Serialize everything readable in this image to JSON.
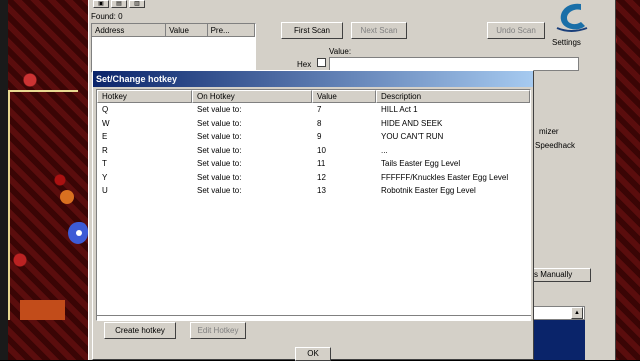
{
  "main": {
    "found": "Found: 0",
    "columns": [
      "Address",
      "Value",
      "Pre..."
    ],
    "first_scan": "First Scan",
    "next_scan": "Next Scan",
    "undo_scan": "Undo Scan",
    "value_label": "Value:",
    "hex_label": "Hex",
    "settings": "Settings",
    "side_text_1": "mizer",
    "side_text_2": "Speedhack",
    "manual_button": "s Manually"
  },
  "dialog": {
    "title": "Set/Change hotkey",
    "headers": [
      "Hotkey",
      "On Hotkey",
      "Value",
      "Description"
    ],
    "rows": [
      {
        "hotkey": "Q",
        "action": "Set value to:",
        "value": "7",
        "description": "HILL Act 1"
      },
      {
        "hotkey": "W",
        "action": "Set value to:",
        "value": "8",
        "description": "HIDE AND SEEK"
      },
      {
        "hotkey": "E",
        "action": "Set value to:",
        "value": "9",
        "description": "YOU CAN'T RUN"
      },
      {
        "hotkey": "R",
        "action": "Set value to:",
        "value": "10",
        "description": "..."
      },
      {
        "hotkey": "T",
        "action": "Set value to:",
        "value": "11",
        "description": "Tails Easter Egg Level"
      },
      {
        "hotkey": "Y",
        "action": "Set value to:",
        "value": "12",
        "description": "FFFFFF/Knuckles Easter Egg Level"
      },
      {
        "hotkey": "U",
        "action": "Set value to:",
        "value": "13",
        "description": "Robotnik Easter Egg Level"
      }
    ],
    "create_hotkey": "Create hotkey",
    "edit_hotkey": "Edit Hotkey",
    "ok": "OK"
  },
  "colors": {
    "titlebar_start": "#0a246a",
    "titlebar_end": "#a6caf0",
    "window_face": "#d4d0c8"
  }
}
